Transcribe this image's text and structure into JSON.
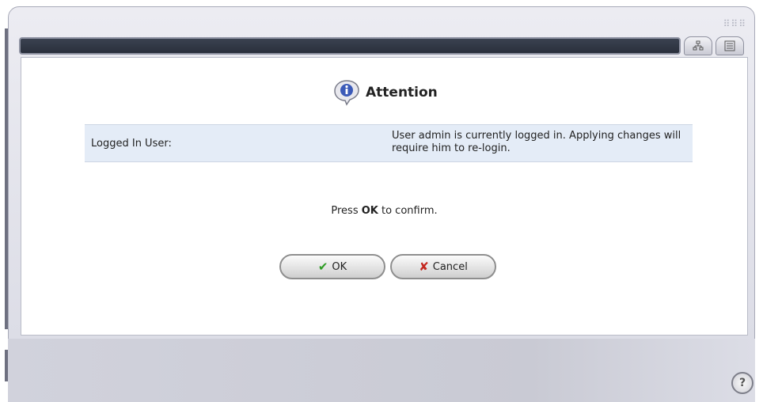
{
  "dialog": {
    "title": "Attention",
    "info_label": "Logged In User:",
    "info_value": "User admin is currently logged in. Applying changes will require him to re-login.",
    "confirm_prefix": "Press ",
    "confirm_bold": "OK",
    "confirm_suffix": " to confirm."
  },
  "buttons": {
    "ok_label": "OK",
    "cancel_label": "Cancel"
  },
  "icons": {
    "ok": "checkmark-icon",
    "cancel": "x-icon",
    "attention": "info-bubble-icon",
    "network": "network-map-icon",
    "list": "list-view-icon",
    "help": "help-icon"
  },
  "colors": {
    "titlebar": "#2f3542",
    "info_row": "#e4ecf7",
    "ok_icon": "#2e9c24",
    "cancel_icon": "#c4261e"
  }
}
